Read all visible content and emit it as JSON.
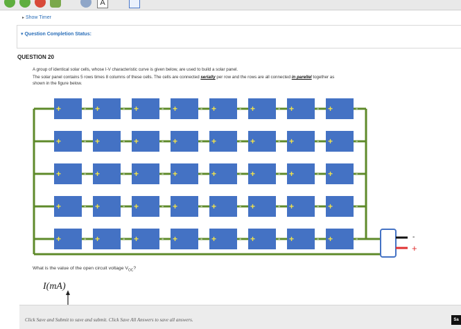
{
  "toolbar": {
    "icons": [
      "green-circle-icon",
      "green-circle-icon",
      "red-circle-icon",
      "green-tree-icon",
      "person-icon",
      "text-icon",
      "grid-icon"
    ],
    "text_icon_label": "A"
  },
  "links": {
    "show_timer": "Show Timer",
    "completion_status": "Question Completion Status:"
  },
  "question": {
    "title": "QUESTION 20",
    "line1": "A group of identical solar cells, whose I-V characteristic curve is given below, are used to build a solar panel.",
    "line2_a": "The solar panel contains 5 rows times 8 columns of these cells. The cells are connected ",
    "line2_b": "serially",
    "line2_c": " per row and the rows are all connected ",
    "line2_d": "in parellel",
    "line2_e": " together as",
    "line3": "shown in the figure below.",
    "ask_prefix": "What is the value of the open circuit voltage V",
    "ask_sub": "OC",
    "ask_suffix": "?",
    "iv_label": "I(mA)"
  },
  "panel": {
    "rows": 5,
    "cols": 8,
    "cell_plus": "+",
    "cell_minus": "-",
    "terminal_minus": "-",
    "terminal_plus": "+",
    "cell_color": "#4472c4",
    "wire_color": "#5e8a2a",
    "plus_color": "#f2e24a",
    "terminal_plus_color": "#e03030"
  },
  "footer": {
    "hint": "Click Save and Submit to save and submit. Click Save All Answers to save all answers.",
    "button_label": "Sa"
  }
}
